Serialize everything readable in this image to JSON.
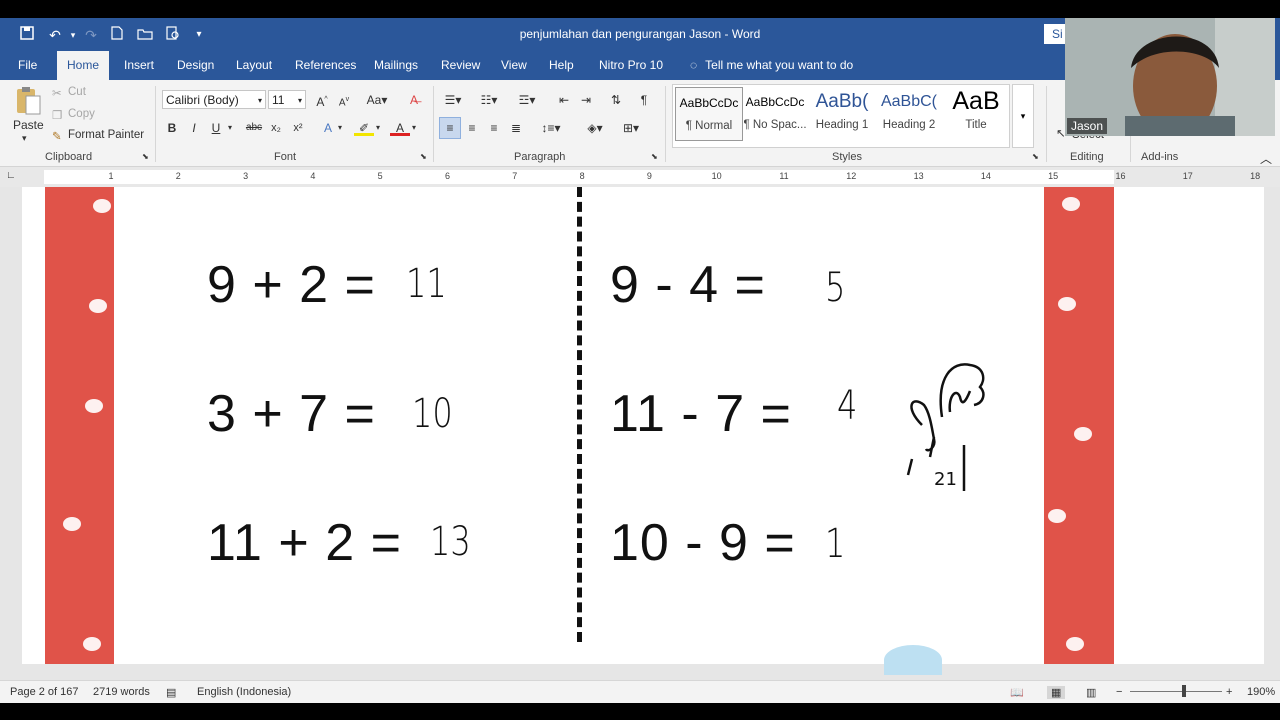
{
  "titlebar": {
    "doc_title": "penjumlahan dan pengurangan Jason  -  Word",
    "signin": "Si"
  },
  "tabs": [
    "File",
    "Home",
    "Insert",
    "Design",
    "Layout",
    "References",
    "Mailings",
    "Review",
    "View",
    "Help",
    "Nitro Pro 10"
  ],
  "active_tab": "Home",
  "tell_me": "Tell me what you want to do",
  "clipboard": {
    "paste": "Paste",
    "cut": "Cut",
    "copy": "Copy",
    "format_painter": "Format Painter",
    "label": "Clipboard"
  },
  "font": {
    "name": "Calibri (Body)",
    "size": "11",
    "label": "Font"
  },
  "paragraph": {
    "label": "Paragraph"
  },
  "styles": {
    "items": [
      {
        "sample": "AaBbCcDc",
        "name": "¶ Normal"
      },
      {
        "sample": "AaBbCcDc",
        "name": "¶ No Spac..."
      },
      {
        "sample": "AaBb(",
        "name": "Heading 1"
      },
      {
        "sample": "AaBbC(",
        "name": "Heading 2"
      },
      {
        "sample": "AaB",
        "name": "Title"
      }
    ],
    "label": "Styles"
  },
  "editing": {
    "label": "Editing",
    "select": "Select"
  },
  "addins": {
    "label": "Add-ins"
  },
  "ruler_numbers": [
    "1",
    "2",
    "3",
    "4",
    "5",
    "6",
    "7",
    "8",
    "9",
    "10",
    "11",
    "12",
    "13",
    "14",
    "15",
    "16",
    "17",
    "18"
  ],
  "worksheet": {
    "left": [
      {
        "problem": "9 + 2 =",
        "answer": "11"
      },
      {
        "problem": "3 + 7 =",
        "answer": "10"
      },
      {
        "problem": "11 + 2 =",
        "answer": "13"
      }
    ],
    "right": [
      {
        "problem": "9 - 4 =",
        "answer": "5"
      },
      {
        "problem": "11 - 7 =",
        "answer": "4"
      },
      {
        "problem": "10 - 9 =",
        "answer": "1"
      }
    ],
    "scribble": "21"
  },
  "status": {
    "page": "Page 2 of 167",
    "words": "2719 words",
    "language": "English (Indonesia)",
    "zoom": "190%"
  },
  "webcam": {
    "name": "Jason"
  },
  "colors": {
    "word_blue": "#2b579a",
    "border_red": "#e05349",
    "ribbon_bg": "#f3f3f3"
  }
}
